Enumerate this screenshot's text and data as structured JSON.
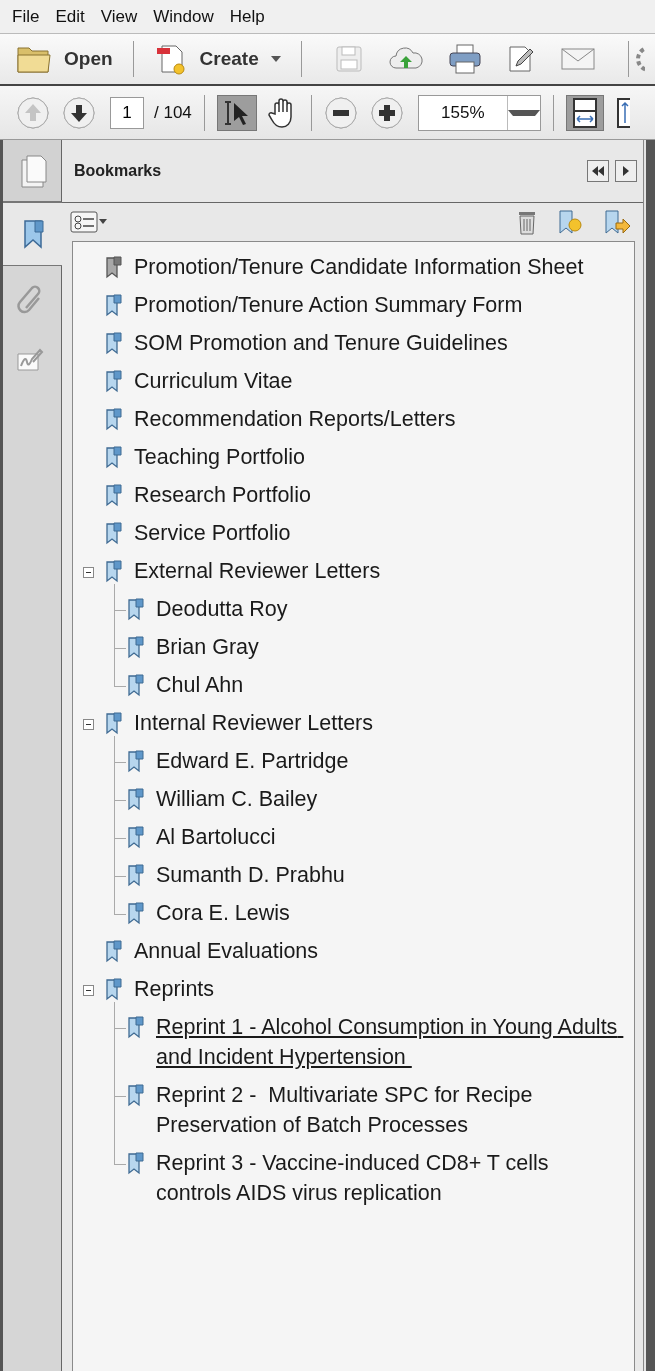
{
  "menu": [
    "File",
    "Edit",
    "View",
    "Window",
    "Help"
  ],
  "toolbar": {
    "open_button": "Open",
    "create_button": "Create"
  },
  "navigation": {
    "page": "1",
    "page_count": "/ 104",
    "zoom": "155%"
  },
  "side_tabs": [
    {
      "kind": "pages",
      "selected": false
    },
    {
      "kind": "bookmarks",
      "selected": true
    },
    {
      "kind": "attachments",
      "selected": false
    },
    {
      "kind": "signatures",
      "selected": false
    }
  ],
  "panel": {
    "title": "Bookmarks"
  },
  "bookmarks": [
    {
      "label": "Promotion/Tenure Candidate Information Sheet",
      "selected": true,
      "hovered": false
    },
    {
      "label": "Promotion/Tenure Action Summary Form",
      "selected": false,
      "hovered": false
    },
    {
      "label": "SOM Promotion and Tenure Guidelines",
      "selected": false,
      "hovered": false
    },
    {
      "label": "Curriculum Vitae",
      "selected": false,
      "hovered": false
    },
    {
      "label": "Recommendation Reports/Letters",
      "selected": false,
      "hovered": false
    },
    {
      "label": "Teaching Portfolio",
      "selected": false,
      "hovered": false
    },
    {
      "label": "Research Portfolio",
      "selected": false,
      "hovered": false
    },
    {
      "label": "Service Portfolio",
      "selected": false,
      "hovered": false
    },
    {
      "label": "External Reviewer Letters",
      "selected": false,
      "hovered": false,
      "expanded": true,
      "children": [
        {
          "label": "Deodutta Roy",
          "selected": false,
          "hovered": false
        },
        {
          "label": "Brian Gray",
          "selected": false,
          "hovered": false
        },
        {
          "label": "Chul Ahn",
          "selected": false,
          "hovered": false
        }
      ]
    },
    {
      "label": "Internal Reviewer Letters",
      "selected": false,
      "hovered": false,
      "expanded": true,
      "children": [
        {
          "label": "Edward E. Partridge",
          "selected": false,
          "hovered": false
        },
        {
          "label": "William C. Bailey",
          "selected": false,
          "hovered": false
        },
        {
          "label": "Al Bartolucci",
          "selected": false,
          "hovered": false
        },
        {
          "label": "Sumanth D. Prabhu",
          "selected": false,
          "hovered": false
        },
        {
          "label": "Cora E. Lewis",
          "selected": false,
          "hovered": false
        }
      ]
    },
    {
      "label": "Annual Evaluations",
      "selected": false,
      "hovered": false
    },
    {
      "label": "Reprints",
      "selected": false,
      "hovered": false,
      "expanded": true,
      "children": [
        {
          "label": "Reprint 1 - Alcohol Consumption in Young Adults and Incident Hypertension ",
          "selected": false,
          "hovered": true
        },
        {
          "label": "Reprint 2 -  Multivariate SPC for Recipe Preservation of Batch Processes",
          "selected": false,
          "hovered": false
        },
        {
          "label": "Reprint 3 - Vaccine-induced CD8+ T cells controls AIDS virus replication",
          "selected": false,
          "hovered": false
        }
      ]
    }
  ]
}
